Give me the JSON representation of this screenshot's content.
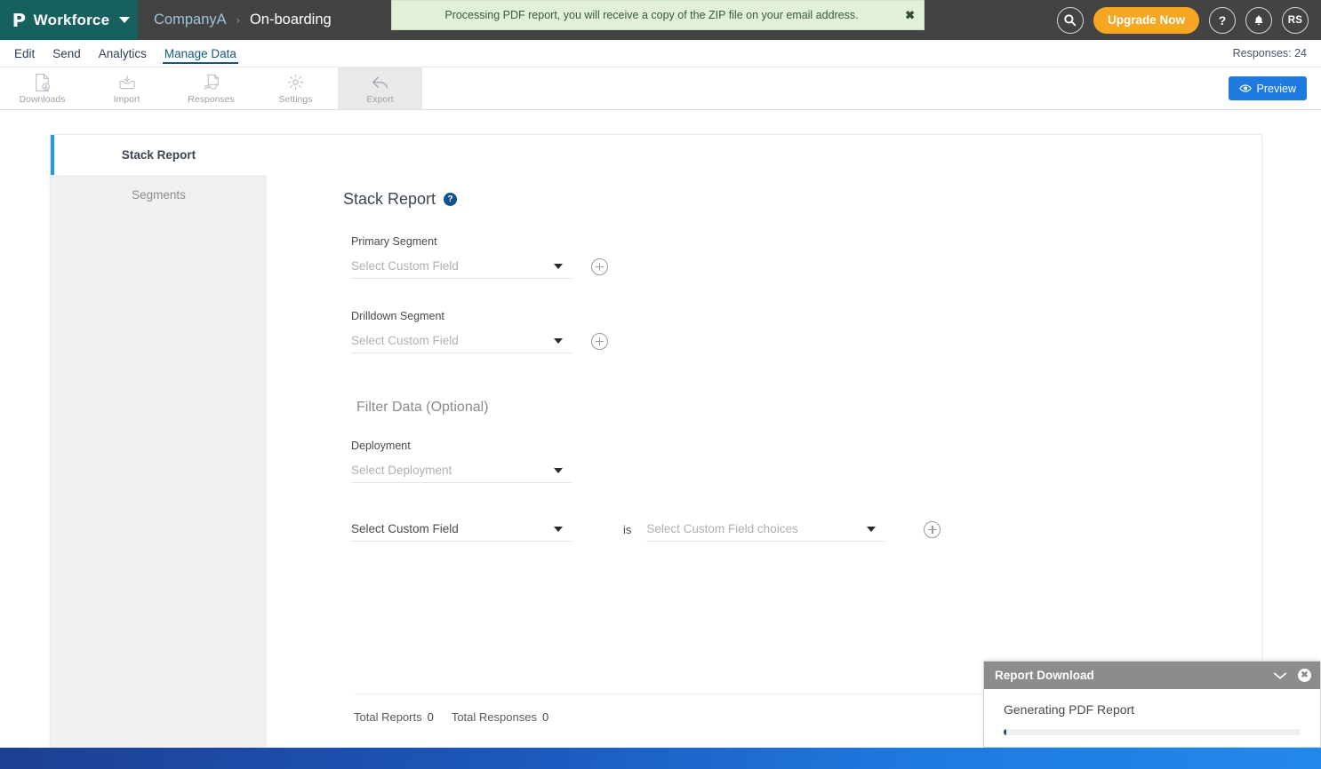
{
  "topbar": {
    "logo_glyph": "P",
    "product_name": "Workforce",
    "breadcrumb": {
      "company": "CompanyA",
      "separator": "›",
      "current": "On-boarding"
    },
    "toast": {
      "message": "Processing PDF report, you will receive a copy of the ZIP file on your email address.",
      "close_label": "✖"
    },
    "actions": {
      "search_title": "Search",
      "upgrade_label": "Upgrade Now",
      "help_label": "?",
      "notifications_title": "Notifications",
      "avatar_initials": "RS"
    }
  },
  "nav": {
    "tabs": [
      {
        "label": "Edit",
        "active": false
      },
      {
        "label": "Send",
        "active": false
      },
      {
        "label": "Analytics",
        "active": false
      },
      {
        "label": "Manage Data",
        "active": true
      }
    ],
    "responses_count": "Responses: 24"
  },
  "toolbar": {
    "items": [
      {
        "label": "Downloads",
        "icon": "file-download-icon",
        "active": false
      },
      {
        "label": "Import",
        "icon": "import-tray-icon",
        "active": false
      },
      {
        "label": "Responses",
        "icon": "responses-hand-icon",
        "active": false
      },
      {
        "label": "Settings",
        "icon": "gear-icon",
        "active": false
      },
      {
        "label": "Export",
        "icon": "export-arrow-icon",
        "active": true
      }
    ],
    "preview_label": "Preview"
  },
  "sidebar": {
    "items": [
      {
        "label": "Stack Report",
        "active": true
      },
      {
        "label": "Segments",
        "active": false
      }
    ]
  },
  "form": {
    "title": "Stack Report",
    "help_glyph": "?",
    "primary_segment": {
      "label": "Primary Segment",
      "value": "",
      "placeholder": "Select Custom Field",
      "add_label": "Add primary segment"
    },
    "drilldown_segment": {
      "label": "Drilldown Segment",
      "value": "",
      "placeholder": "Select Custom Field",
      "add_label": "Add drilldown segment"
    },
    "filter_section_title": "Filter Data (Optional)",
    "deployment": {
      "label": "Deployment",
      "value": "",
      "placeholder": "Select Deployment"
    },
    "condition": {
      "field_placeholder": "Select Custom Field",
      "operator": "is",
      "choices_placeholder": "Select Custom Field choices",
      "add_label": "Add filter condition"
    },
    "totals": {
      "reports_label": "Total Reports",
      "reports_value": "0",
      "responses_label": "Total Responses",
      "responses_value": "0"
    }
  },
  "download_panel": {
    "title": "Report Download",
    "collapse_label": "Collapse",
    "close_label": "✖",
    "status": "Generating PDF Report",
    "progress_percent": 1
  },
  "colors": {
    "brand_teal": "#16615e",
    "topbar_dark": "#434343",
    "accent_blue": "#2196f3",
    "primary_button": "#1f7ae0",
    "upgrade_orange": "#f5a623",
    "toast_green_bg": "#e2f0d9",
    "help_badge_blue": "#0b5394",
    "progress_fill": "#1b4f96"
  }
}
